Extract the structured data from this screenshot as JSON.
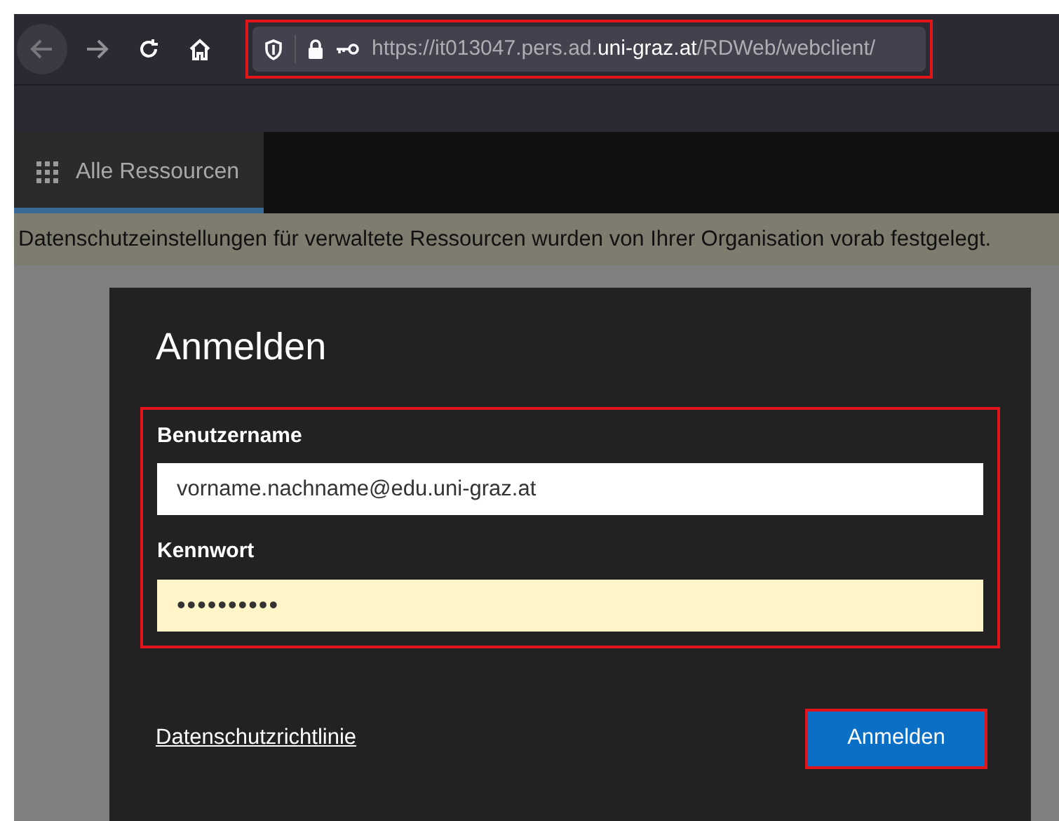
{
  "browser": {
    "url": {
      "prefix": "https://it013047.pers.ad.",
      "domain": "uni-graz.at",
      "suffix": "/RDWeb/webclient/"
    },
    "highlighted": true
  },
  "tabs": [
    {
      "label": "Alle Ressourcen",
      "selected": true
    }
  ],
  "banner": "Datenschutzeinstellungen für verwaltete Ressourcen wurden von Ihrer Organisation vorab festgelegt.",
  "dialog": {
    "title": "Anmelden",
    "fields_highlighted": true,
    "fields": [
      {
        "label": "Benutzername",
        "value": "vorname.nachname@edu.uni-graz.at",
        "autofilled": false
      },
      {
        "label": "Kennwort",
        "value": "••••••••••",
        "autofilled": true
      }
    ],
    "link": "Datenschutzrichtlinie",
    "button": {
      "label": "Anmelden",
      "highlighted": true
    }
  }
}
